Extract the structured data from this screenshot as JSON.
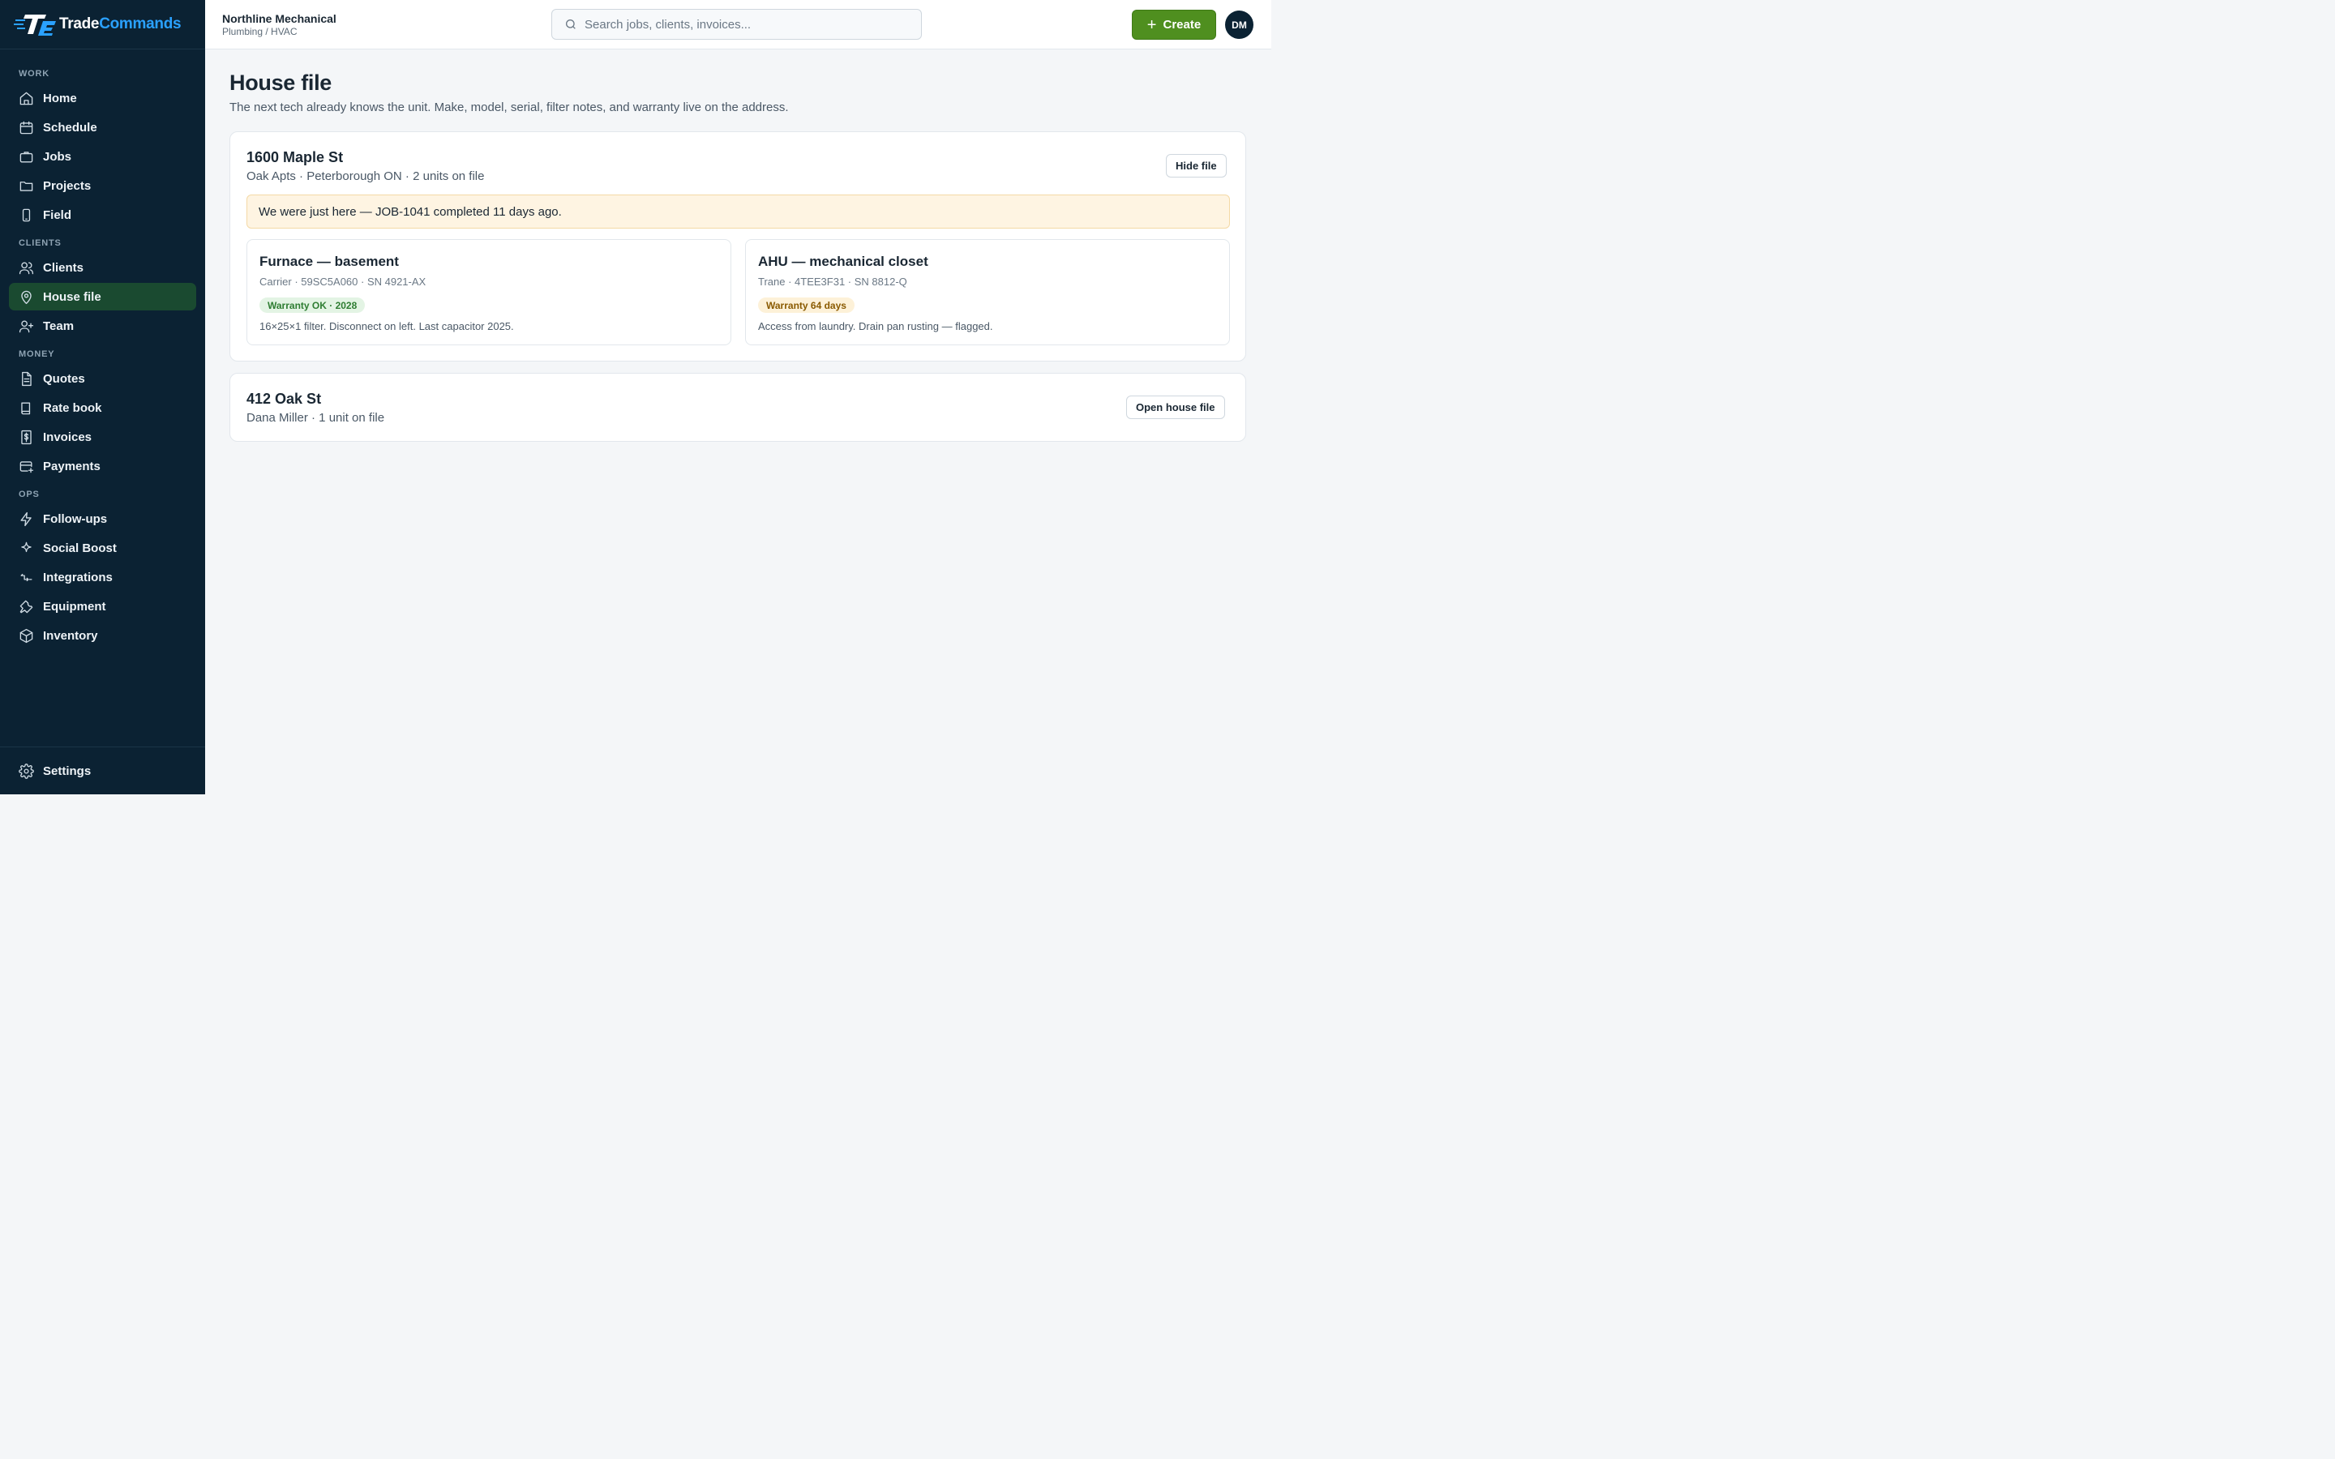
{
  "brand": {
    "name_part1": "Trade",
    "name_part2": "Commands",
    "accent": "#2aa1ff"
  },
  "sidebar": {
    "sections": [
      {
        "label": "WORK",
        "items": [
          {
            "label": "Home",
            "icon": "home-icon"
          },
          {
            "label": "Schedule",
            "icon": "calendar-icon"
          },
          {
            "label": "Jobs",
            "icon": "briefcase-icon"
          },
          {
            "label": "Projects",
            "icon": "folder-icon"
          },
          {
            "label": "Field",
            "icon": "phone-icon"
          }
        ]
      },
      {
        "label": "CLIENTS",
        "items": [
          {
            "label": "Clients",
            "icon": "users-icon"
          },
          {
            "label": "House file",
            "icon": "map-pin-icon",
            "active": true
          },
          {
            "label": "Team",
            "icon": "user-plus-icon"
          }
        ]
      },
      {
        "label": "MONEY",
        "items": [
          {
            "label": "Quotes",
            "icon": "file-text-icon"
          },
          {
            "label": "Rate book",
            "icon": "book-icon"
          },
          {
            "label": "Invoices",
            "icon": "dollar-receipt-icon"
          },
          {
            "label": "Payments",
            "icon": "card-add-icon"
          }
        ]
      },
      {
        "label": "OPS",
        "items": [
          {
            "label": "Follow-ups",
            "icon": "lightning-icon"
          },
          {
            "label": "Social Boost",
            "icon": "sparkle-icon"
          },
          {
            "label": "Integrations",
            "icon": "integration-icon"
          },
          {
            "label": "Equipment",
            "icon": "wrench-icon"
          },
          {
            "label": "Inventory",
            "icon": "box-icon"
          }
        ]
      }
    ],
    "footer": {
      "label": "Settings",
      "icon": "gear-icon"
    }
  },
  "topbar": {
    "org_name": "Northline Mechanical",
    "org_sub": "Plumbing / HVAC",
    "search_placeholder": "Search jobs, clients, invoices...",
    "create_label": "Create",
    "avatar_initials": "DM",
    "create_color": "#4f8f1f"
  },
  "page": {
    "title": "House file",
    "subtitle": "The next tech already knows the unit. Make, model, serial, filter notes, and warranty live on the address."
  },
  "houses": [
    {
      "address": "1600 Maple St",
      "meta": "Oak Apts · Peterborough ON · 2 units on file",
      "button": "Hide file",
      "notice": "We were just here — JOB-1041 completed 11 days ago.",
      "units": [
        {
          "title": "Furnace — basement",
          "spec": "Carrier · 59SC5A060 · SN 4921-AX",
          "warranty": "Warranty OK · 2028",
          "status": "ok",
          "note": "16×25×1 filter. Disconnect on left. Last capacitor 2025."
        },
        {
          "title": "AHU — mechanical closet",
          "spec": "Trane · 4TEE3F31 · SN 8812-Q",
          "warranty": "Warranty 64 days",
          "status": "warn",
          "note": "Access from laundry. Drain pan rusting — flagged."
        }
      ]
    },
    {
      "address": "412 Oak St",
      "meta": "Dana Miller · 1 unit on file",
      "button": "Open house file"
    }
  ]
}
